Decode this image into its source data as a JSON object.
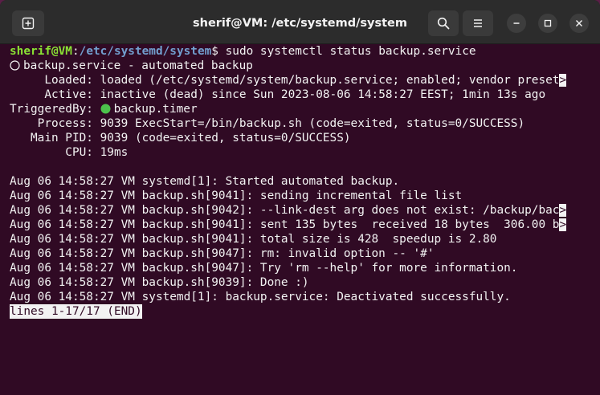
{
  "window": {
    "title": "sherif@VM: /etc/systemd/system"
  },
  "icons": {
    "new_tab": "new-tab-icon",
    "search": "search-icon",
    "menu": "hamburger-menu-icon",
    "minimize": "minimize-icon",
    "maximize": "maximize-icon",
    "close": "close-icon"
  },
  "terminal": {
    "prompt": {
      "user": "sherif@VM",
      "sep": ":",
      "path": "/etc/systemd/system",
      "dollar": "$",
      "command": " sudo systemctl status backup.service"
    },
    "status": {
      "header": "backup.service - automated backup",
      "loaded_label": "     Loaded: ",
      "loaded_value": "loaded (/etc/systemd/system/backup.service; enabled; vendor preset",
      "active_label": "     Active: ",
      "active_value": "inactive (dead) since Sun 2023-08-06 14:58:27 EEST; 1min 13s ago",
      "triggered_label": "TriggeredBy: ",
      "triggered_value": "backup.timer",
      "process_label": "    Process: ",
      "process_value": "9039 ExecStart=/bin/backup.sh (code=exited, status=0/SUCCESS)",
      "mainpid_label": "   Main PID: ",
      "mainpid_value": "9039 (code=exited, status=0/SUCCESS)",
      "cpu_label": "        CPU: ",
      "cpu_value": "19ms"
    },
    "log_lines": [
      "Aug 06 14:58:27 VM systemd[1]: Started automated backup.",
      "Aug 06 14:58:27 VM backup.sh[9041]: sending incremental file list",
      "Aug 06 14:58:27 VM backup.sh[9042]: --link-dest arg does not exist: /backup/bac",
      "Aug 06 14:58:27 VM backup.sh[9041]: sent 135 bytes  received 18 bytes  306.00 b",
      "Aug 06 14:58:27 VM backup.sh[9041]: total size is 428  speedup is 2.80",
      "Aug 06 14:58:27 VM backup.sh[9047]: rm: invalid option -- '#'",
      "Aug 06 14:58:27 VM backup.sh[9047]: Try 'rm --help' for more information.",
      "Aug 06 14:58:27 VM backup.sh[9039]: Done :)",
      "Aug 06 14:58:27 VM systemd[1]: backup.service: Deactivated successfully."
    ],
    "truncation_marker": ">",
    "pager_status": "lines 1-17/17 (END)"
  },
  "colors": {
    "background": "#300a24",
    "titlebar": "#2c2c2c",
    "prompt_user": "#8ae234",
    "prompt_path": "#729fcf",
    "active_dot": "#4cc24c"
  }
}
